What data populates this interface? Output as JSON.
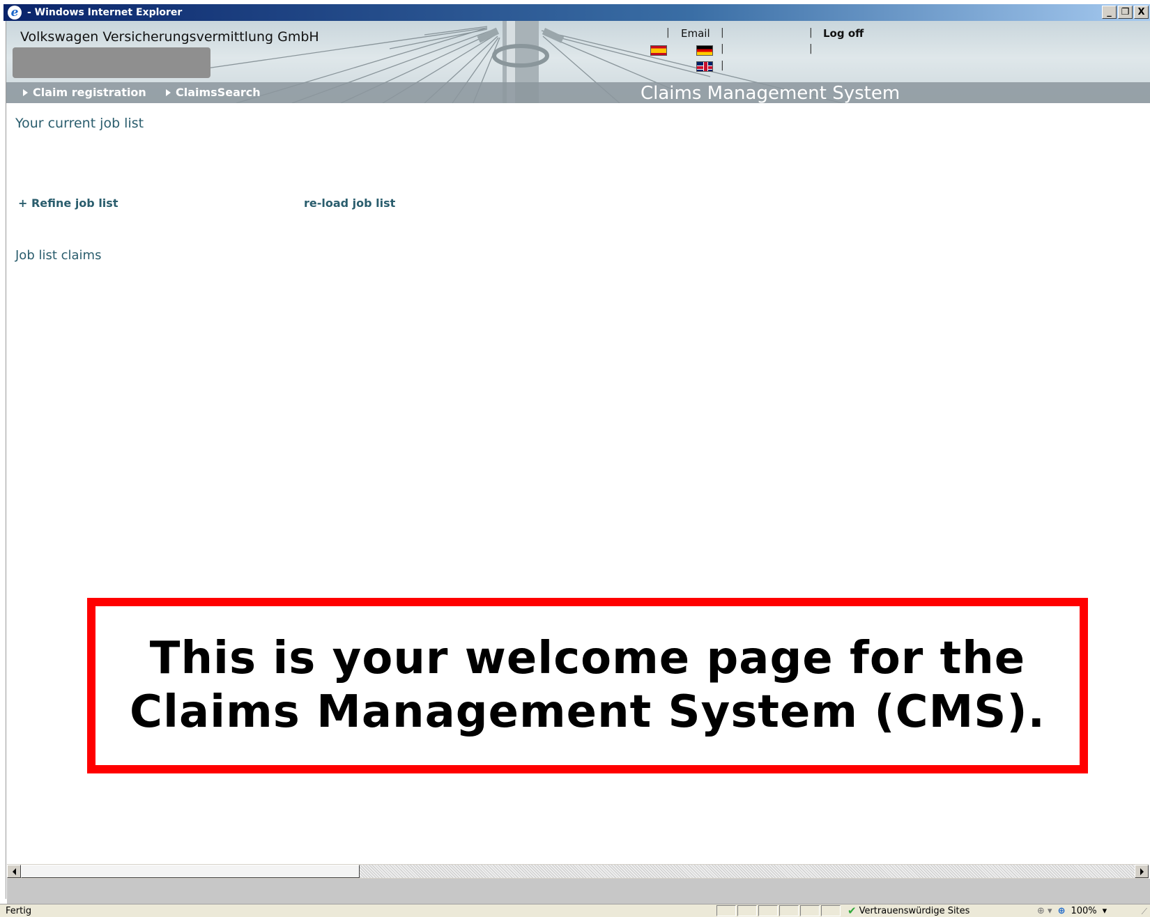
{
  "window": {
    "title": "- Windows Internet Explorer",
    "controls": {
      "minimize": "_",
      "restore": "❐",
      "close": "X"
    }
  },
  "header": {
    "company": "Volkswagen Versicherungsvermittlung GmbH",
    "email_label": "Email",
    "logoff_label": "Log off",
    "flags": [
      "flag-spain-icon",
      "flag-germany-icon",
      "flag-uk-icon"
    ],
    "system_title": "Claims Management System",
    "nav": [
      {
        "label": "Claim registration"
      },
      {
        "label": "ClaimsSearch"
      }
    ]
  },
  "content": {
    "current_job_list_heading": "Your current job list",
    "refine_label": "+ Refine job list",
    "reload_label": "re-load job list",
    "job_list_claims_heading": "Job list claims"
  },
  "callout": {
    "line1": "This is your welcome page for the",
    "line2": "Claims Management System (CMS).",
    "border_color": "#ff0000"
  },
  "statusbar": {
    "status_text": "Fertig",
    "zone": "Vertrauenswürdige Sites",
    "zoom": "100%"
  },
  "colors": {
    "link": "#2a5d6d",
    "titlebar_start": "#0a246a",
    "navbar": "#8c969e"
  }
}
